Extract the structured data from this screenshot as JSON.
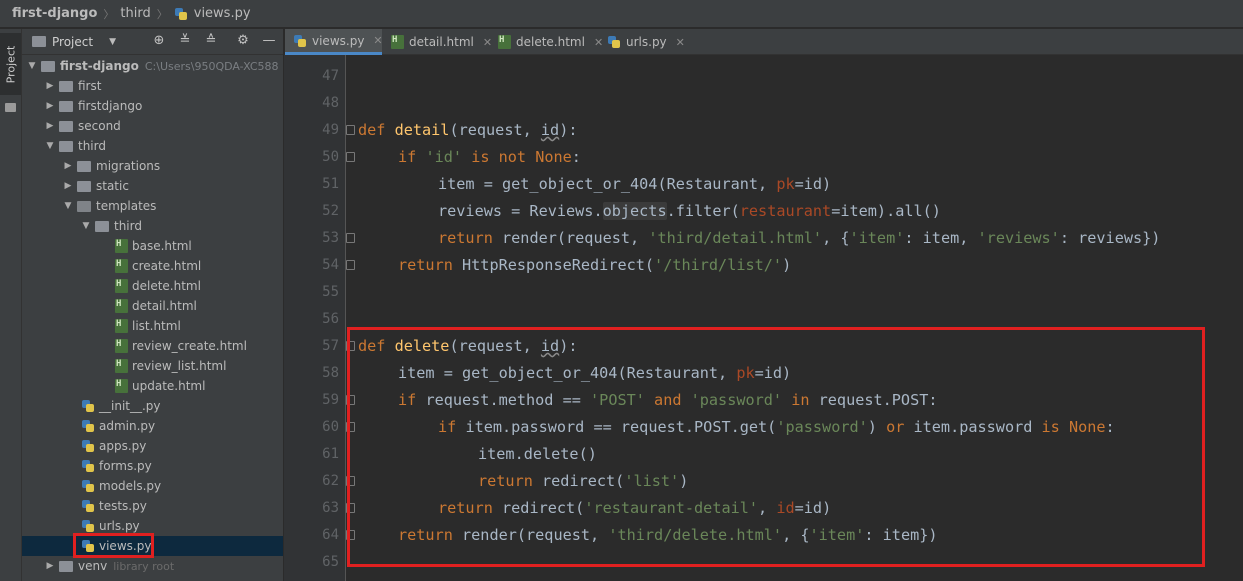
{
  "breadcrumb": {
    "project": "first-django",
    "folder": "third",
    "file": "views.py"
  },
  "sidebar_tab": "Project",
  "project_panel": {
    "title": "Project",
    "tree": [
      {
        "label": "first-django",
        "hint": "C:\\Users\\950QDA-XC588",
        "bold": true
      },
      {
        "label": "first"
      },
      {
        "label": "firstdjango"
      },
      {
        "label": "second"
      },
      {
        "label": "third"
      },
      {
        "label": "migrations"
      },
      {
        "label": "static"
      },
      {
        "label": "templates"
      },
      {
        "label": "third"
      },
      {
        "label": "base.html"
      },
      {
        "label": "create.html"
      },
      {
        "label": "delete.html"
      },
      {
        "label": "detail.html"
      },
      {
        "label": "list.html"
      },
      {
        "label": "review_create.html"
      },
      {
        "label": "review_list.html"
      },
      {
        "label": "update.html"
      },
      {
        "label": "__init__.py"
      },
      {
        "label": "admin.py"
      },
      {
        "label": "apps.py"
      },
      {
        "label": "forms.py"
      },
      {
        "label": "models.py"
      },
      {
        "label": "tests.py"
      },
      {
        "label": "urls.py"
      },
      {
        "label": "views.py",
        "selected": true
      },
      {
        "label": "venv",
        "hint": "library root"
      }
    ]
  },
  "tabs": [
    {
      "label": "views.py",
      "active": true
    },
    {
      "label": "detail.html"
    },
    {
      "label": "delete.html"
    },
    {
      "label": "urls.py"
    }
  ],
  "line_numbers": [
    "47",
    "48",
    "49",
    "50",
    "51",
    "52",
    "53",
    "54",
    "55",
    "56",
    "57",
    "58",
    "59",
    "60",
    "61",
    "62",
    "63",
    "64",
    "65"
  ],
  "code": {
    "l49": {
      "kw": "def",
      "fn": "detail",
      "a": "(request, ",
      "id": "id",
      "b": "):"
    },
    "l50": {
      "kw1": "if",
      "str": "'id'",
      "kw2": "is not None",
      "end": ":"
    },
    "l51": {
      "a": "item = get_object_or_404(Restaurant, ",
      "nm": "pk",
      "b": "=id)"
    },
    "l52": {
      "a": "reviews = Reviews.",
      "hl": "objects",
      "b": ".filter(",
      "nm": "restaurant",
      "c": "=item).all()"
    },
    "l53": {
      "kw": "return",
      "a": " render(request, ",
      "s1": "'third/detail.html'",
      "b": ", {",
      "s2": "'item'",
      "c": ": item, ",
      "s3": "'reviews'",
      "d": ": reviews})"
    },
    "l54": {
      "kw": "return",
      "a": " HttpResponseRedirect(",
      "s": "'/third/list/'",
      "b": ")"
    },
    "l57": {
      "kw": "def",
      "fn": "delete",
      "a": "(request, ",
      "id": "id",
      "b": "):"
    },
    "l58": {
      "a": "item = get_object_or_404(Restaurant, ",
      "nm": "pk",
      "b": "=id)"
    },
    "l59": {
      "kw1": "if",
      "a": " request.method == ",
      "s1": "'POST'",
      "kw2": " and ",
      "s2": "'password'",
      "kw3": " in ",
      "b": "request.POST:"
    },
    "l60": {
      "kw1": "if",
      "a": " item.password == request.POST.get(",
      "s": "'password'",
      "b": ") ",
      "kw2": "or",
      "c": " item.password ",
      "kw3": "is None",
      "d": ":"
    },
    "l61": {
      "a": "item.delete()"
    },
    "l62": {
      "kw": "return",
      "a": " redirect(",
      "s": "'list'",
      "b": ")"
    },
    "l63": {
      "kw": "return",
      "a": " redirect(",
      "s": "'restaurant-detail'",
      "b": ", ",
      "nm": "id",
      "c": "=id)"
    },
    "l64": {
      "kw": "return",
      "a": " render(request, ",
      "s1": "'third/delete.html'",
      "b": ", {",
      "s2": "'item'",
      "c": ": item})"
    }
  },
  "colors": {
    "keyword": "#cc7832",
    "function": "#ffc66d",
    "string": "#6a8759",
    "named_arg": "#aa4926",
    "text": "#a9b7c6",
    "highlight_box": "#e02020"
  }
}
